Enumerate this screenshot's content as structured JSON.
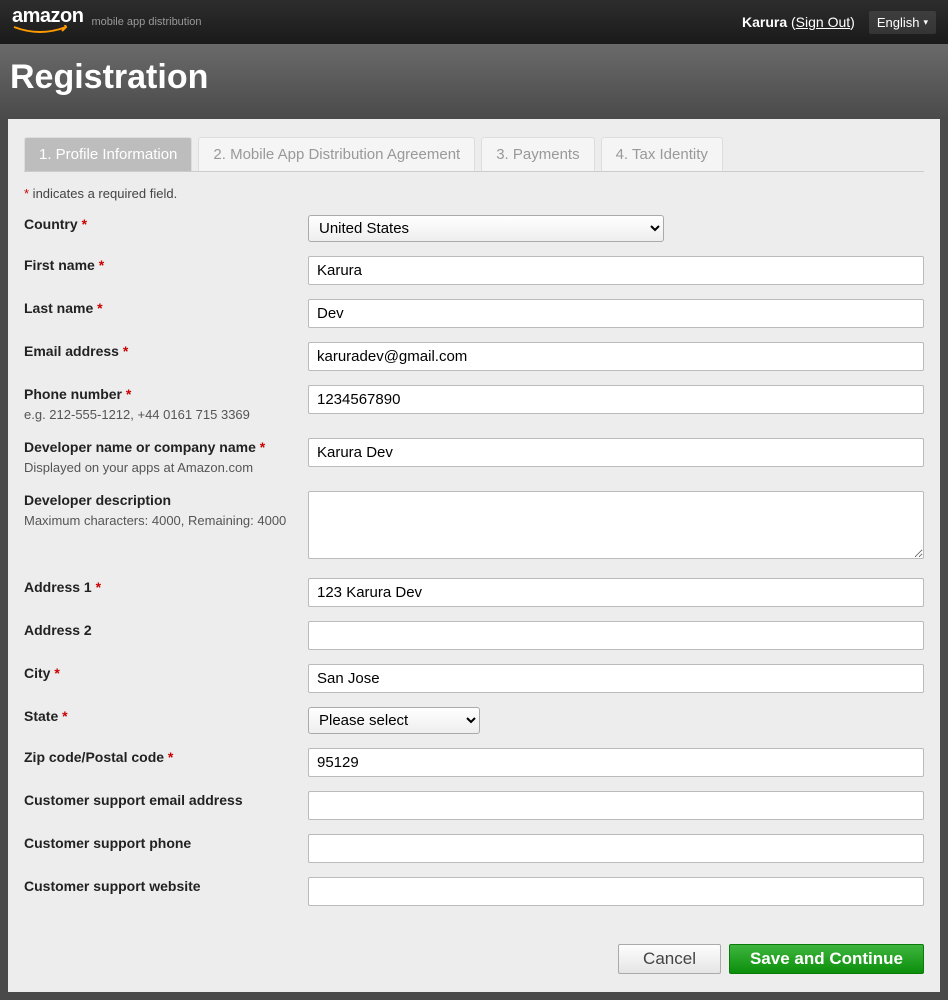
{
  "header": {
    "logo_main": "amazon",
    "logo_sub": "mobile app distribution",
    "user_name": "Karura",
    "sign_out": "Sign Out",
    "language": "English"
  },
  "page_title": "Registration",
  "tabs": [
    {
      "label": "1. Profile Information",
      "active": true
    },
    {
      "label": "2. Mobile App Distribution Agreement",
      "active": false
    },
    {
      "label": "3. Payments",
      "active": false
    },
    {
      "label": "4. Tax Identity",
      "active": false
    }
  ],
  "required_note": " indicates a required field.",
  "fields": {
    "country": {
      "label": "Country",
      "value": "United States",
      "required": true
    },
    "first_name": {
      "label": "First name",
      "value": "Karura",
      "required": true
    },
    "last_name": {
      "label": "Last name",
      "value": "Dev",
      "required": true
    },
    "email": {
      "label": "Email address",
      "value": "karuradev@gmail.com",
      "required": true
    },
    "phone": {
      "label": "Phone number",
      "value": "1234567890",
      "hint": "e.g. 212-555-1212, +44 0161 715 3369",
      "required": true
    },
    "dev_name": {
      "label": "Developer name or company name",
      "value": "Karura Dev",
      "hint": "Displayed on your apps at Amazon.com",
      "required": true
    },
    "dev_desc": {
      "label": "Developer description",
      "value": "",
      "hint": "Maximum characters: 4000, Remaining: 4000",
      "required": false
    },
    "address1": {
      "label": "Address 1",
      "value": "123 Karura Dev",
      "required": true
    },
    "address2": {
      "label": "Address 2",
      "value": "",
      "required": false
    },
    "city": {
      "label": "City",
      "value": "San Jose",
      "required": true
    },
    "state": {
      "label": "State",
      "value": "Please select",
      "required": true
    },
    "zip": {
      "label": "Zip code/Postal code",
      "value": "95129",
      "required": true
    },
    "support_email": {
      "label": "Customer support email address",
      "value": "",
      "required": false
    },
    "support_phone": {
      "label": "Customer support phone",
      "value": "",
      "required": false
    },
    "support_web": {
      "label": "Customer support website",
      "value": "",
      "required": false
    }
  },
  "buttons": {
    "cancel": "Cancel",
    "save": "Save and Continue"
  }
}
